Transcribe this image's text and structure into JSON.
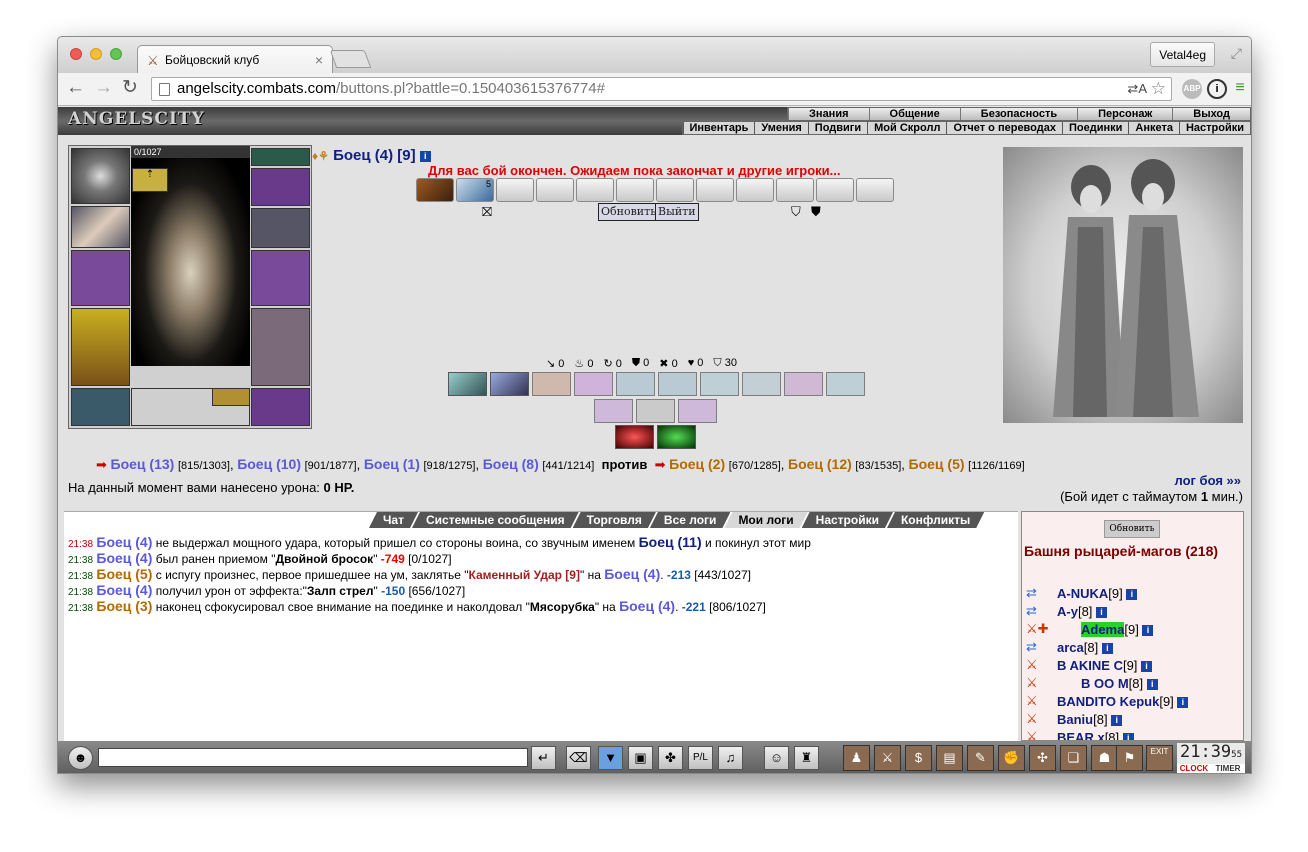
{
  "browser": {
    "tab_title": "Бойцовский клуб",
    "user": "Vetal4eg",
    "url_host": "angelscity.combats.com",
    "url_path": "/buttons.pl?battle=0.150403615376774#"
  },
  "site": {
    "logo": "ANGELSCITY",
    "menu_top": [
      "Знания",
      "Общение",
      "Безопасность",
      "Персонаж",
      "Выход"
    ],
    "menu_bottom": [
      "Инвентарь",
      "Умения",
      "Подвиги",
      "Мой Скролл",
      "Отчет о переводах",
      "Поединки",
      "Анкета",
      "Настройки"
    ]
  },
  "fighter": {
    "hp": "0/1027",
    "name": "Боец (4)",
    "level": "[9]",
    "info": "i"
  },
  "battle": {
    "message": "Для вас бой окончен. Ожидаем пока закончат и другие игроки...",
    "scroll_count": "5",
    "refresh_btn": "Обновить",
    "exit_btn": "Выйти",
    "stats": [
      "0",
      "0",
      "0",
      "0",
      "0",
      "0",
      "30"
    ],
    "team_left": [
      {
        "name": "Боец (13)",
        "hp": "[815/1303]"
      },
      {
        "name": "Боец (10)",
        "hp": "[901/1877]"
      },
      {
        "name": "Боец (1)",
        "hp": "[918/1275]"
      },
      {
        "name": "Боец (8)",
        "hp": "[441/1214]"
      }
    ],
    "versus": "против",
    "team_right": [
      {
        "name": "Боец (2)",
        "hp": "[670/1285]"
      },
      {
        "name": "Боец (12)",
        "hp": "[83/1535]"
      },
      {
        "name": "Боец (5)",
        "hp": "[1126/1169]"
      }
    ],
    "log_link": "лог боя »»",
    "damage_prefix": "На данный момент вами нанесено урона:",
    "damage_value": "0 HP.",
    "timeout_prefix": "(Бой идет с таймаутом",
    "timeout_value": "1",
    "timeout_suffix": "мин.)"
  },
  "chat": {
    "tabs": [
      "Чат",
      "Системные сообщения",
      "Торговля",
      "Все логи",
      "Мои логи",
      "Настройки",
      "Конфликты"
    ],
    "active_tab": "Мои логи",
    "lines": [
      {
        "time": "21:38",
        "actor": "Боец (4)",
        "text": "не выдержал мощного удара, который пришел со стороны воина, со звучным именем",
        "target": "Боец (11)",
        "rest": "и покинул этот мир"
      },
      {
        "time": "21:38",
        "actor": "Боец (4)",
        "text": "был ранен приемом \"",
        "skill": "Двойной бросок",
        "after": "\"",
        "dmg": "-749",
        "hp": "[0/1027]"
      },
      {
        "time": "21:38",
        "actor": "Боец (5)",
        "text": "с испугу произнес, первое пришедшее на ум, заклятье \"",
        "skill": "Каменный Удар [9]",
        "after": "\" на",
        "target": "Боец (4)",
        "dmg": "-213",
        "hp": "[443/1027]"
      },
      {
        "time": "21:38",
        "actor": "Боец (4)",
        "text": "получил урон от эффекта:\"",
        "skill": "Залп стрел",
        "after": "\"",
        "dmg": "-150",
        "hp": "[656/1027]"
      },
      {
        "time": "21:38",
        "actor": "Боец (3)",
        "text": "наконец сфокусировал свое внимание на поединке и наколдовал \"",
        "skill": "Мясорубка",
        "after": "\" на",
        "target": "Боец (4)",
        "dmg": "-221",
        "hp": "[806/1027]"
      }
    ]
  },
  "room": {
    "refresh": "Обновить",
    "title": "Башня рыцарей-магов (218)",
    "players": [
      {
        "name": "A-NUKA",
        "level": "[9]"
      },
      {
        "name": "A-y",
        "level": "[8]"
      },
      {
        "name": "Adema",
        "level": "[9]"
      },
      {
        "name": "arca",
        "level": "[8]"
      },
      {
        "name": "B AKINE C",
        "level": "[9]"
      },
      {
        "name": "B OO M",
        "level": "[8]"
      },
      {
        "name": "BANDITO Kepuk",
        "level": "[9]"
      },
      {
        "name": "Baniu",
        "level": "[8]"
      },
      {
        "name": "BEAR x",
        "level": "[8]"
      }
    ]
  },
  "clock": {
    "time": "21:39",
    "sec": "55",
    "clock_label": "CLOCK",
    "timer_label": "TIMER",
    "exit": "EXIT"
  }
}
